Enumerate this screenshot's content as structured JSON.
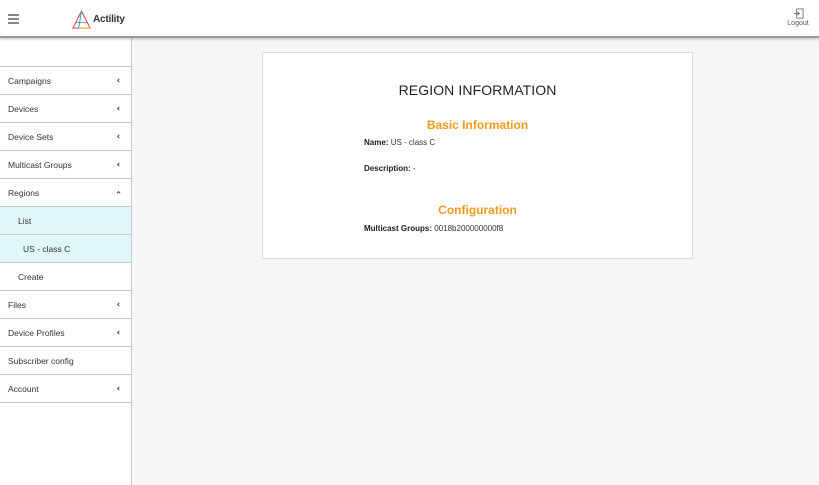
{
  "header": {
    "logo_text": "Actility",
    "logout_label": "Logout"
  },
  "sidebar": {
    "items": [
      {
        "label": "Campaigns",
        "chevron": "left"
      },
      {
        "label": "Devices",
        "chevron": "left"
      },
      {
        "label": "Device Sets",
        "chevron": "left"
      },
      {
        "label": "Multicast Groups",
        "chevron": "left"
      },
      {
        "label": "Regions",
        "chevron": "up"
      }
    ],
    "regions_sub": [
      {
        "label": "List"
      },
      {
        "label": "US - class C"
      },
      {
        "label": "Create"
      }
    ],
    "items_after": [
      {
        "label": "Files",
        "chevron": "left"
      },
      {
        "label": "Device Profiles",
        "chevron": "left"
      },
      {
        "label": "Subscriber config"
      },
      {
        "label": "Account",
        "chevron": "left"
      }
    ]
  },
  "region": {
    "title": "REGION INFORMATION",
    "basic_title": "Basic Information",
    "name_label": "Name:",
    "name_value": "US - class C",
    "description_label": "Description:",
    "description_value": "-",
    "config_title": "Configuration",
    "multicast_label": "Multicast Groups:",
    "multicast_value": "0018b200000000f8"
  },
  "colors": {
    "accent": "#f29b1f",
    "active_bg": "#dff7f8"
  }
}
